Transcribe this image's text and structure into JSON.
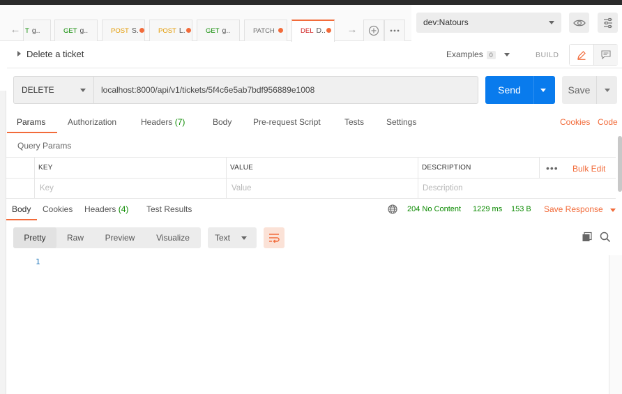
{
  "tabs": {
    "items": [
      {
        "method": "T",
        "name": "g..",
        "unsaved": false
      },
      {
        "method": "GET",
        "name": "g..",
        "unsaved": false
      },
      {
        "method": "POST",
        "name": "S.",
        "unsaved": true
      },
      {
        "method": "POST",
        "name": "L.",
        "unsaved": true
      },
      {
        "method": "GET",
        "name": "g..",
        "unsaved": false
      },
      {
        "method": "PATCH",
        "name": "",
        "unsaved": true
      },
      {
        "method": "DEL",
        "name": "D..",
        "unsaved": true,
        "active": true
      }
    ]
  },
  "environment": {
    "selected": "dev:Natours"
  },
  "request": {
    "title": "Delete a ticket",
    "examples_label": "Examples",
    "examples_count": "0",
    "build_label": "BUILD",
    "method": "DELETE",
    "url": "localhost:8000/api/v1/tickets/5f4c6e5ab7bdf956889e1008",
    "send_label": "Send",
    "save_label": "Save"
  },
  "request_tabs": {
    "params": "Params",
    "authorization": "Authorization",
    "headers": "Headers",
    "headers_count": "(7)",
    "body": "Body",
    "prerequest": "Pre-request Script",
    "tests": "Tests",
    "settings": "Settings",
    "cookies": "Cookies",
    "code": "Code"
  },
  "query_params": {
    "title": "Query Params",
    "columns": {
      "key": "KEY",
      "value": "VALUE",
      "description": "DESCRIPTION"
    },
    "bulk_edit": "Bulk Edit",
    "placeholders": {
      "key": "Key",
      "value": "Value",
      "description": "Description"
    }
  },
  "response_tabs": {
    "body": "Body",
    "cookies": "Cookies",
    "headers": "Headers",
    "headers_count": "(4)",
    "test_results": "Test Results"
  },
  "response_status": {
    "status": "204 No Content",
    "time": "1229 ms",
    "size": "153 B",
    "save_response": "Save Response"
  },
  "body_view": {
    "modes": [
      "Pretty",
      "Raw",
      "Preview",
      "Visualize"
    ],
    "active_mode": "Pretty",
    "type": "Text",
    "line_numbers": [
      "1"
    ]
  },
  "colors": {
    "accent": "#f26b3a",
    "send_blue": "#097bed",
    "status_green": "#0b8a00",
    "delete_red": "#d02020",
    "post_orange": "#e39a00"
  }
}
